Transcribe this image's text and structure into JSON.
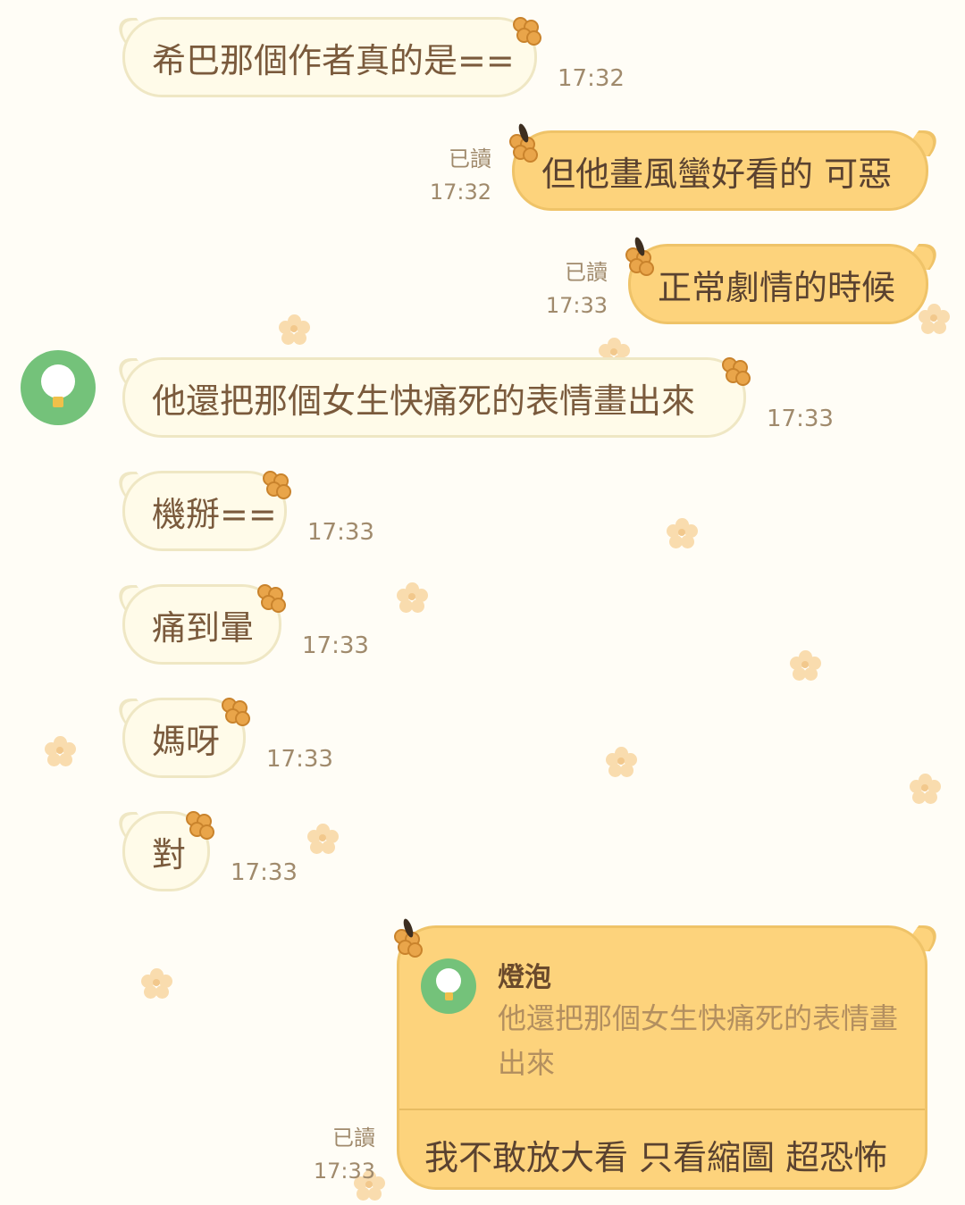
{
  "messages": [
    {
      "text": "希巴那個作者真的是==",
      "time": "17:32"
    },
    {
      "text": "但他畫風蠻好看的 可惡",
      "read": "已讀",
      "time": "17:32"
    },
    {
      "text": "正常劇情的時候",
      "read": "已讀",
      "time": "17:33"
    },
    {
      "text": "他還把那個女生快痛死的表情畫出來",
      "time": "17:33"
    },
    {
      "text": "機掰==",
      "time": "17:33"
    },
    {
      "text": "痛到暈",
      "time": "17:33"
    },
    {
      "text": "媽呀",
      "time": "17:33"
    },
    {
      "text": "對",
      "time": "17:33"
    }
  ],
  "reply": {
    "quoted_sender": "燈泡",
    "quoted_text": "他還把那個女生快痛死的表情畫出來",
    "text": "我不敢放大看 只看縮圖 超恐怖",
    "read": "已讀",
    "time": "17:33"
  },
  "colors": {
    "background": "#fffdf6",
    "incoming_bubble": "#fffbe9",
    "outgoing_bubble": "#fdd37c",
    "avatar": "#74c27a"
  },
  "icons": [
    "lightbulb-avatar",
    "flower-icon"
  ]
}
